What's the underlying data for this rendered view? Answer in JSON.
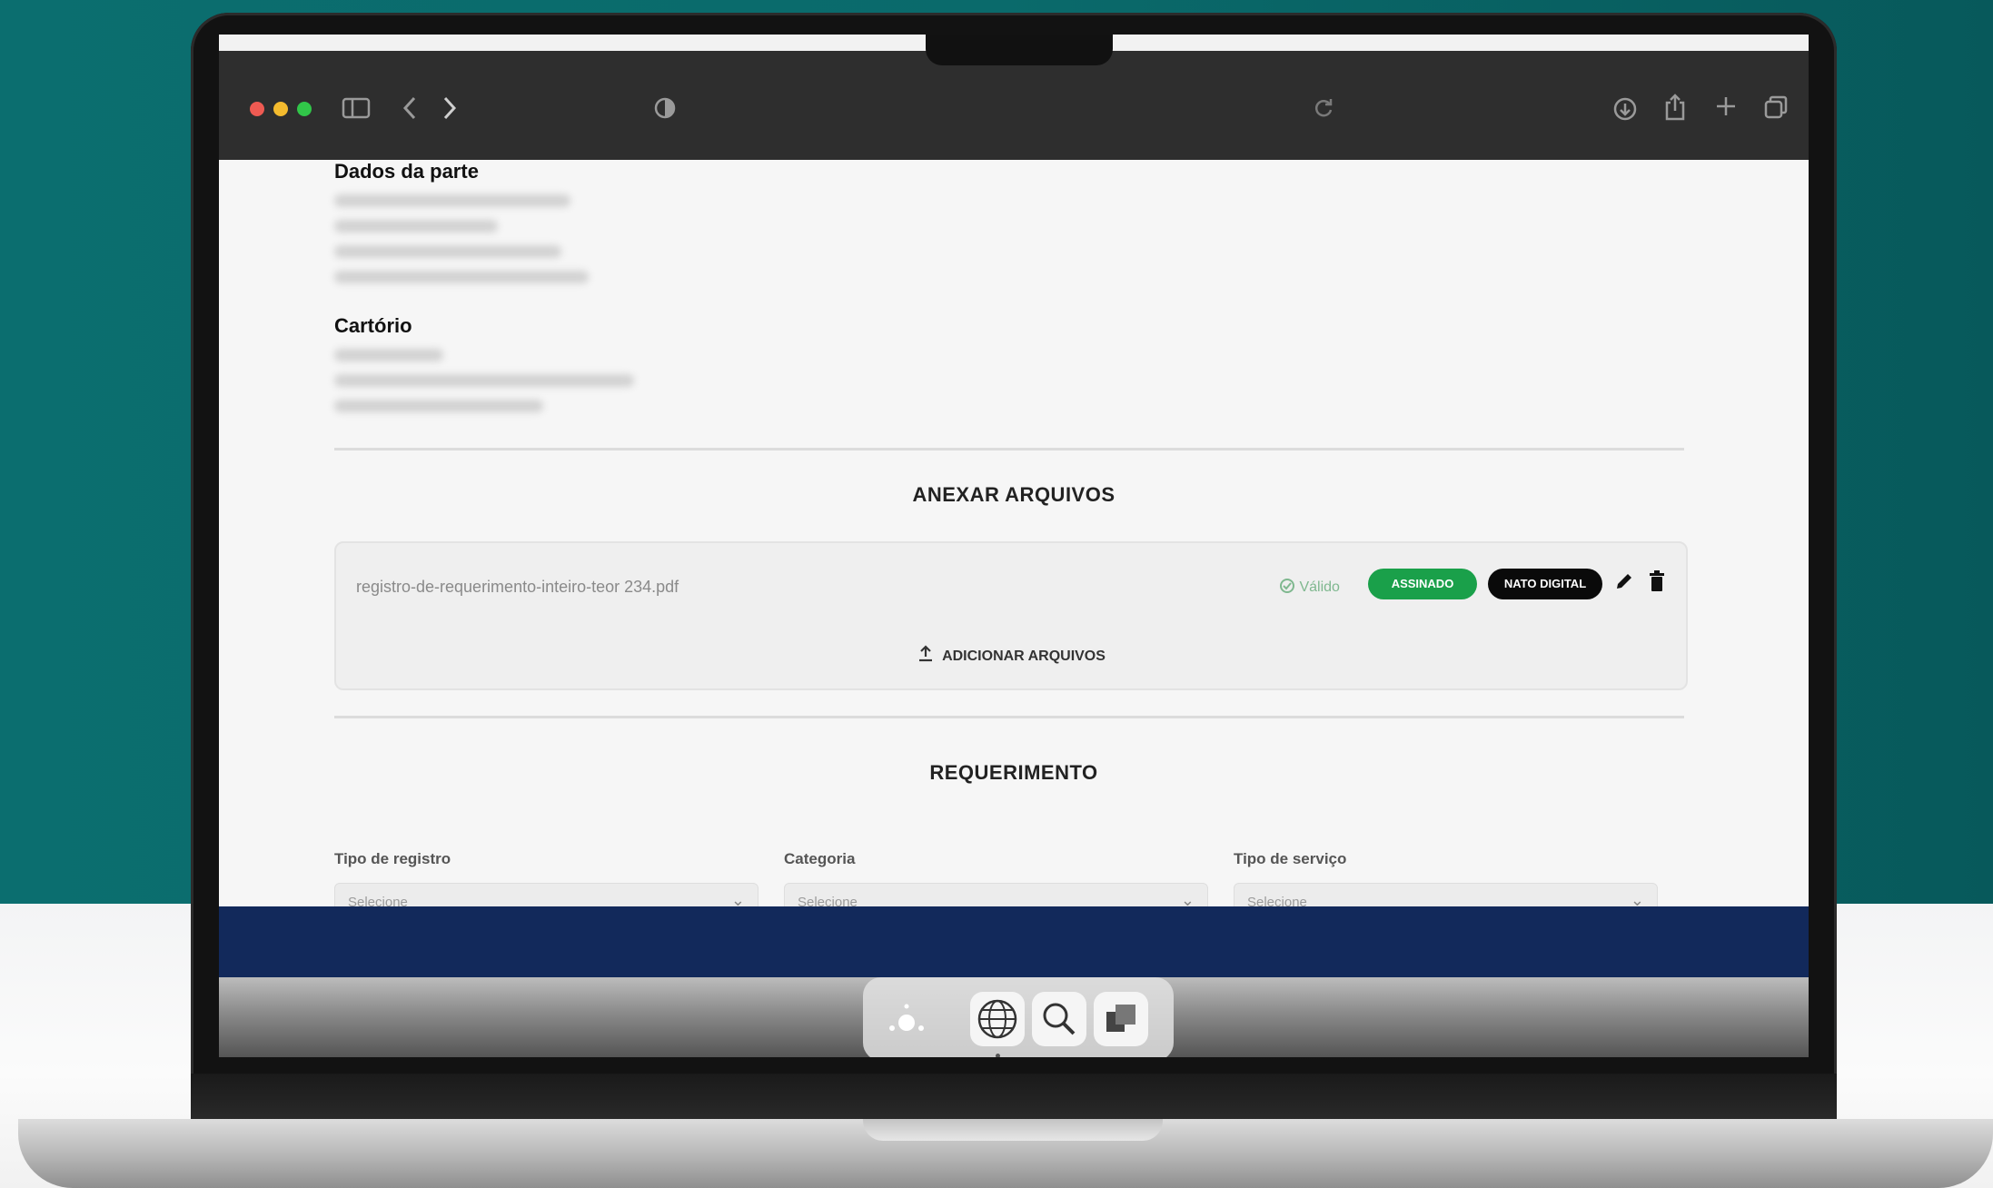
{
  "colors": {
    "accent_green": "#1aa04a",
    "badge_black": "#0a0a0a",
    "background_teal": "#0b6e6f",
    "footer_navy": "#12295b"
  },
  "toolbar": {
    "icons": [
      "sidebar-icon",
      "back-icon",
      "forward-icon",
      "privacy-shield-icon",
      "reload-icon",
      "download-icon",
      "share-icon",
      "new-tab-icon",
      "tabs-overview-icon"
    ]
  },
  "party": {
    "heading": "Dados da parte"
  },
  "registry": {
    "heading": "Cartório"
  },
  "attachments": {
    "title": "ANEXAR ARQUIVOS",
    "file": {
      "name": "registro-de-requerimento-inteiro-teor 234.pdf",
      "status": "Válido",
      "signed_badge": "ASSINADO",
      "native_badge": "NATO DIGITAL"
    },
    "add_label": "ADICIONAR ARQUIVOS"
  },
  "request": {
    "title": "REQUERIMENTO",
    "fields": [
      {
        "label": "Tipo de registro",
        "placeholder": "Selecione"
      },
      {
        "label": "Categoria",
        "placeholder": "Selecione"
      },
      {
        "label": "Tipo de serviço",
        "placeholder": "Selecione"
      }
    ]
  },
  "dock": {
    "icons": [
      "launchpad-icon",
      "safari-globe-icon",
      "spotlight-search-icon",
      "preview-icon"
    ]
  }
}
